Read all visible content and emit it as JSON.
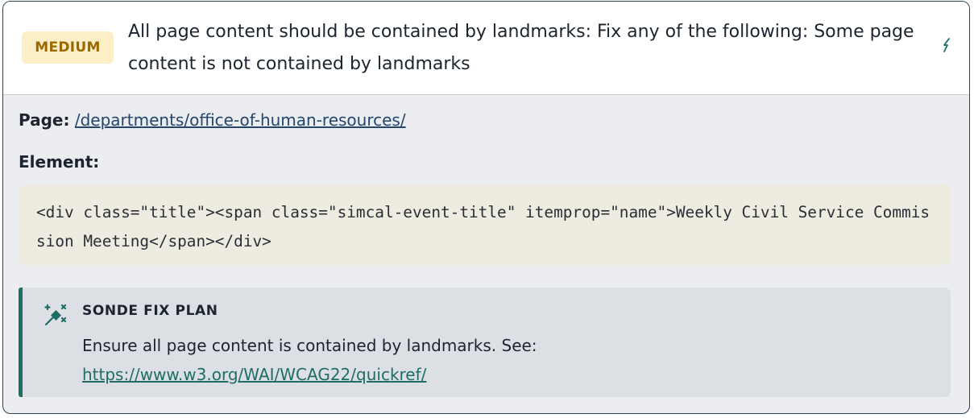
{
  "issue": {
    "severity": "MEDIUM",
    "title": "All page content should be contained by landmarks: Fix any of the following: Some page content is not contained by landmarks",
    "edit_icon": "magic-wand-icon"
  },
  "details": {
    "page_label": "Page:",
    "page_url": "/departments/office-of-human-resources/",
    "element_label": "Element:",
    "element_code": "<div class=\"title\"><span class=\"simcal-event-title\" itemprop=\"name\">Weekly Civil Service Commission Meeting</span></div>"
  },
  "fix_plan": {
    "icon": "magic-wand-sparkle-icon",
    "title": "SONDE FIX PLAN",
    "text": "Ensure all page content is contained by landmarks. See:",
    "link": "https://www.w3.org/WAI/WCAG22/quickref/"
  },
  "colors": {
    "badge_bg": "#fcefc7",
    "badge_text": "#9a6a00",
    "accent": "#1e6e66",
    "card_border": "#2f4256"
  }
}
